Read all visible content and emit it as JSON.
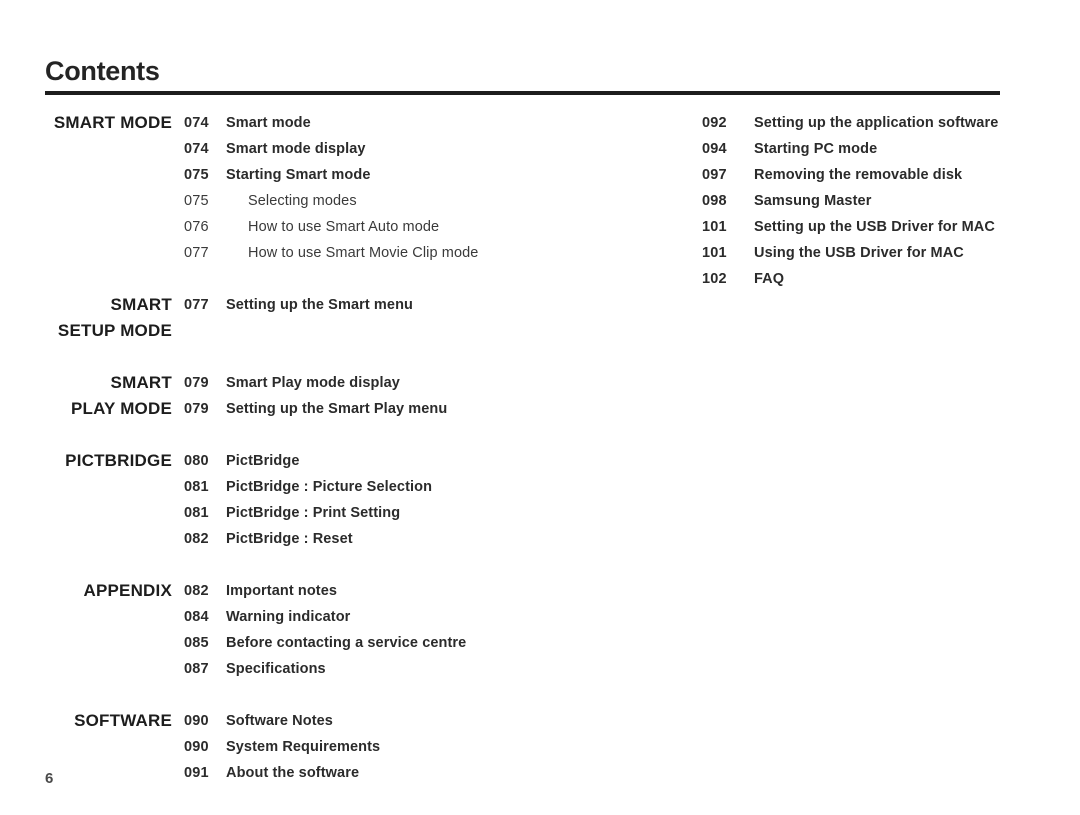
{
  "header": {
    "title": "Contents"
  },
  "footer": {
    "page_number": "6"
  },
  "colors": {
    "text": "#2b2b2b",
    "heading": "#1d1d1d",
    "rule": "#1d1d1d",
    "page_number": "#4a4a4a",
    "background": "#ffffff"
  },
  "left_column": {
    "groups": [
      {
        "label": "SMART MODE",
        "label_lines": [
          "SMART MODE"
        ],
        "vertical_center": false,
        "entries": [
          {
            "num": "074",
            "text": "Smart mode",
            "sub": false
          },
          {
            "num": "074",
            "text": "Smart mode display",
            "sub": false
          },
          {
            "num": "075",
            "text": "Starting Smart mode",
            "sub": false
          },
          {
            "num": "075",
            "text": "Selecting modes",
            "sub": true
          },
          {
            "num": "076",
            "text": "How to use Smart Auto mode",
            "sub": true
          },
          {
            "num": "077",
            "text": "How to use Smart Movie Clip mode",
            "sub": true
          }
        ]
      },
      {
        "label": "SMART\nSETUP MODE",
        "label_lines": [
          "SMART",
          "SETUP MODE"
        ],
        "vertical_center": true,
        "entries": [
          {
            "num": "077",
            "text": "Setting up the Smart menu",
            "sub": false
          }
        ]
      },
      {
        "label": "SMART\nPLAY MODE",
        "label_lines": [
          "SMART",
          "PLAY MODE"
        ],
        "vertical_center": false,
        "entries": [
          {
            "num": "079",
            "text": "Smart Play mode display",
            "sub": false
          },
          {
            "num": "079",
            "text": "Setting up the Smart Play menu",
            "sub": false
          }
        ]
      },
      {
        "label": "PICTBRIDGE",
        "label_lines": [
          "PICTBRIDGE"
        ],
        "vertical_center": false,
        "entries": [
          {
            "num": "080",
            "text": "PictBridge",
            "sub": false
          },
          {
            "num": "081",
            "text": "PictBridge : Picture Selection",
            "sub": false
          },
          {
            "num": "081",
            "text": "PictBridge : Print Setting",
            "sub": false
          },
          {
            "num": "082",
            "text": "PictBridge : Reset",
            "sub": false
          }
        ]
      },
      {
        "label": "APPENDIX",
        "label_lines": [
          "APPENDIX"
        ],
        "vertical_center": false,
        "entries": [
          {
            "num": "082",
            "text": "Important notes",
            "sub": false
          },
          {
            "num": "084",
            "text": "Warning indicator",
            "sub": false
          },
          {
            "num": "085",
            "text": "Before contacting a service centre",
            "sub": false
          },
          {
            "num": "087",
            "text": "Specifications",
            "sub": false
          }
        ]
      },
      {
        "label": "SOFTWARE",
        "label_lines": [
          "SOFTWARE"
        ],
        "vertical_center": false,
        "entries": [
          {
            "num": "090",
            "text": "Software Notes",
            "sub": false
          },
          {
            "num": "090",
            "text": "System Requirements",
            "sub": false
          },
          {
            "num": "091",
            "text": "About the software",
            "sub": false
          }
        ]
      }
    ]
  },
  "right_column": {
    "entries": [
      {
        "num": "092",
        "text": "Setting up the application software",
        "sub": false
      },
      {
        "num": "094",
        "text": "Starting PC mode",
        "sub": false
      },
      {
        "num": "097",
        "text": "Removing the removable disk",
        "sub": false
      },
      {
        "num": "098",
        "text": "Samsung Master",
        "sub": false
      },
      {
        "num": "101",
        "text": "Setting up the USB Driver for MAC",
        "sub": false
      },
      {
        "num": "101",
        "text": "Using the USB Driver for MAC",
        "sub": false
      },
      {
        "num": "102",
        "text": "FAQ",
        "sub": false
      }
    ]
  }
}
